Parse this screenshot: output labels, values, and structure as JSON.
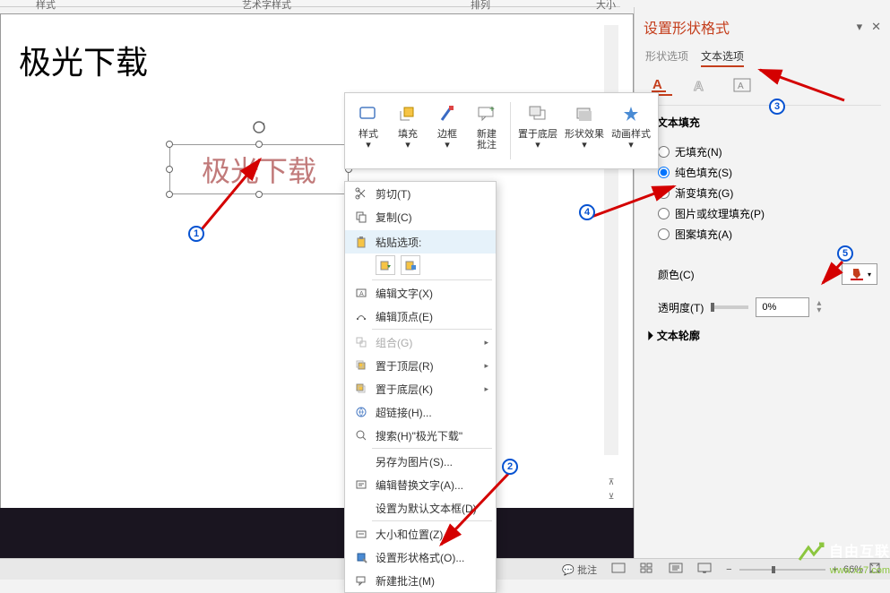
{
  "ribbon": {
    "groups": [
      "样式",
      "艺术字样式",
      "排列",
      "大小"
    ]
  },
  "slide": {
    "main_title": "极光下载",
    "textbox_text": "极光下载"
  },
  "mini_toolbar": {
    "style": "样式",
    "fill": "填充",
    "outline": "边框",
    "new_comment_l1": "新建",
    "new_comment_l2": "批注",
    "send_back": "置于底层",
    "shape_effects": "形状效果",
    "anim_styles": "动画样式"
  },
  "context_menu": {
    "cut": "剪切(T)",
    "copy": "复制(C)",
    "paste_options": "粘贴选项:",
    "edit_text": "编辑文字(X)",
    "edit_points": "编辑顶点(E)",
    "group": "组合(G)",
    "bring_front": "置于顶层(R)",
    "send_back": "置于底层(K)",
    "hyperlink": "超链接(H)...",
    "search": "搜索(H)\"极光下载\"",
    "save_as_pic": "另存为图片(S)...",
    "edit_alt": "编辑替换文字(A)...",
    "set_default_textbox": "设置为默认文本框(D)",
    "size_position": "大小和位置(Z)...",
    "format_shape": "设置形状格式(O)...",
    "new_comment": "新建批注(M)"
  },
  "format_pane": {
    "title": "设置形状格式",
    "tab_shape": "形状选项",
    "tab_text": "文本选项",
    "section_text_fill": "文本填充",
    "section_text_outline": "文本轮廓",
    "radio_no_fill": "无填充(N)",
    "radio_solid": "纯色填充(S)",
    "radio_gradient": "渐变填充(G)",
    "radio_picture": "图片或纹理填充(P)",
    "radio_pattern": "图案填充(A)",
    "color_label": "颜色(C)",
    "transparency_label": "透明度(T)",
    "transparency_value": "0%"
  },
  "status_bar": {
    "comments": "批注",
    "zoom": "66%"
  },
  "watermark": {
    "text": "自由互联",
    "url": "www.xz7.com"
  },
  "badges": {
    "b1": "1",
    "b2": "2",
    "b3": "3",
    "b4": "4",
    "b5": "5"
  }
}
